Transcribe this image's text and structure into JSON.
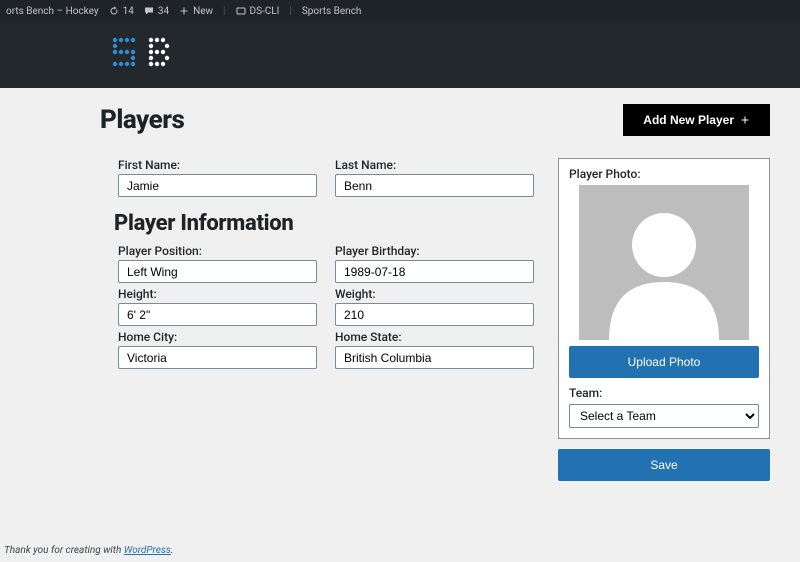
{
  "adminbar": {
    "site_name": "orts Bench – Hockey",
    "updates": "14",
    "comments": "34",
    "new_label": "New",
    "dscli": "DS-CLI",
    "sports_bench": "Sports Bench"
  },
  "page": {
    "title": "Players",
    "add_new": "Add New Player",
    "section_info": "Player Information"
  },
  "fields": {
    "first_name": {
      "label": "First Name:",
      "value": "Jamie"
    },
    "last_name": {
      "label": "Last Name:",
      "value": "Benn"
    },
    "position": {
      "label": "Player Position:",
      "value": "Left Wing"
    },
    "birthday": {
      "label": "Player Birthday:",
      "value": "1989-07-18"
    },
    "height": {
      "label": "Height:",
      "value": "6' 2\""
    },
    "weight": {
      "label": "Weight:",
      "value": "210"
    },
    "home_city": {
      "label": "Home City:",
      "value": "Victoria"
    },
    "home_state": {
      "label": "Home State:",
      "value": "British Columbia"
    }
  },
  "sidebar": {
    "photo_label": "Player Photo:",
    "upload": "Upload Photo",
    "team_label": "Team:",
    "team_value": "Select a Team",
    "save": "Save"
  },
  "footer": {
    "text": "Thank you for creating with ",
    "link": "WordPress",
    "period": "."
  }
}
